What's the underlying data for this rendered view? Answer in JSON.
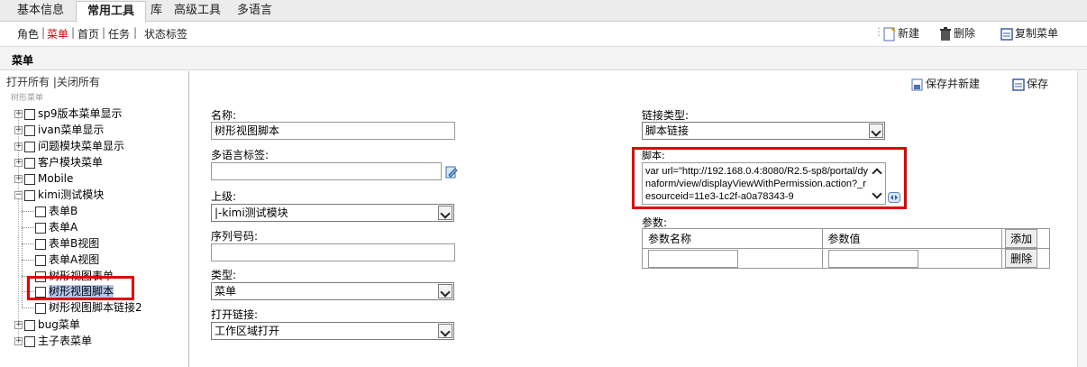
{
  "tabs": [
    "基本信息",
    "常用工具",
    "库",
    "高级工具",
    "多语言"
  ],
  "subnav": {
    "items": [
      "角色",
      "菜单",
      "首页",
      "任务",
      "状态标签"
    ]
  },
  "toolbar": {
    "new": "新建",
    "delete": "删除",
    "copy_menu": "复制菜单"
  },
  "section": {
    "title": "菜单"
  },
  "tree": {
    "expand_all": "打开所有",
    "collapse_all": "|关闭所有",
    "root": "树形菜单",
    "nodes": [
      "sp9版本菜单显示",
      "ivan菜单显示",
      "问题模块菜单显示",
      "客户模块菜单",
      "Mobile",
      "kimi测试模块",
      "表单B",
      "表单A",
      "表单B视图",
      "表单A视图",
      "树形视图表单",
      "树形视图脚本",
      "树形视图脚本链接2",
      "bug菜单",
      "主子表菜单"
    ]
  },
  "actions": {
    "save_new": "保存并新建",
    "save": "保存"
  },
  "form": {
    "name_label": "名称:",
    "name_value": "树形视图脚本",
    "ml_label": "多语言标签:",
    "ml_value": "",
    "parent_label": "上级:",
    "parent_value": "|-kimi测试模块",
    "seq_label": "序列号码:",
    "seq_value": "",
    "type_label": "类型:",
    "type_value": "菜单",
    "open_label": "打开链接:",
    "open_value": "工作区域打开",
    "link_type_label": "链接类型:",
    "link_type_value": "脚本链接",
    "script_label": "脚本:",
    "script_value": "var url=\"http://192.168.0.4:8080/R2.5-sp8/portal/dynaform/view/displayViewWithPermission.action?_resourceid=11e3-1c2f-a0a78343-9",
    "params_label": "参数:",
    "params_col_name": "参数名称",
    "params_col_value": "参数值",
    "add_btn": "添加",
    "remove_btn": "删除"
  },
  "colors": {
    "highlight": "#e00000",
    "active_nav": "#d40000",
    "selected_bg": "#b4c8ec"
  }
}
